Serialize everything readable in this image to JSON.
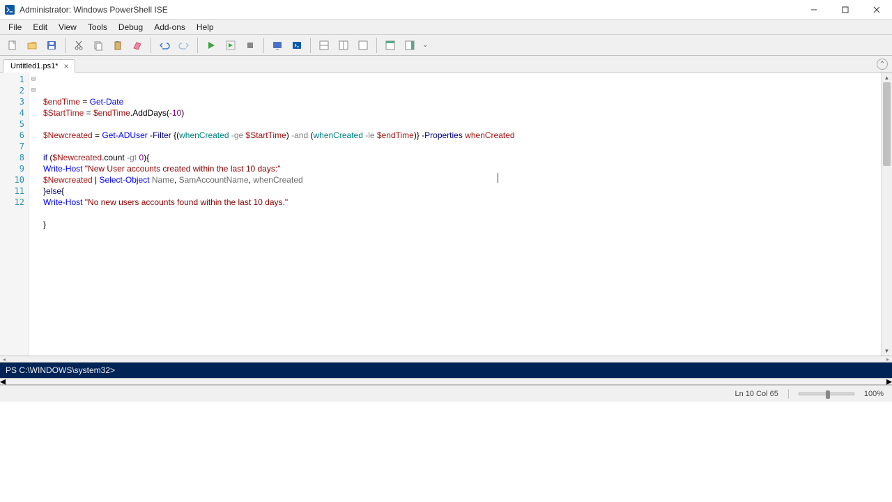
{
  "window": {
    "title": "Administrator: Windows PowerShell ISE"
  },
  "menu": {
    "items": [
      "File",
      "Edit",
      "View",
      "Tools",
      "Debug",
      "Add-ons",
      "Help"
    ]
  },
  "tabs": {
    "items": [
      {
        "label": "Untitled1.ps1*"
      }
    ]
  },
  "code": {
    "lines": [
      [
        {
          "t": "$endTime",
          "c": "tok-var"
        },
        {
          "t": " = ",
          "c": ""
        },
        {
          "t": "Get-Date",
          "c": "tok-cmd"
        }
      ],
      [
        {
          "t": "$StartTime",
          "c": "tok-var"
        },
        {
          "t": " = ",
          "c": ""
        },
        {
          "t": "$endTime",
          "c": "tok-var"
        },
        {
          "t": ".AddDays(",
          "c": "tok-member"
        },
        {
          "t": "-10",
          "c": "tok-num"
        },
        {
          "t": ")",
          "c": "tok-member"
        }
      ],
      [],
      [
        {
          "t": "$Newcreated",
          "c": "tok-var"
        },
        {
          "t": " = ",
          "c": ""
        },
        {
          "t": "Get-ADUser",
          "c": "tok-cmd"
        },
        {
          "t": " -Filter ",
          "c": "tok-param"
        },
        {
          "t": "{(",
          "c": ""
        },
        {
          "t": "whenCreated",
          "c": "tok-type"
        },
        {
          "t": " -ge ",
          "c": "tok-op"
        },
        {
          "t": "$StartTime",
          "c": "tok-var"
        },
        {
          "t": ") ",
          "c": ""
        },
        {
          "t": "-and",
          "c": "tok-op"
        },
        {
          "t": " (",
          "c": ""
        },
        {
          "t": "whenCreated",
          "c": "tok-type"
        },
        {
          "t": " -le ",
          "c": "tok-op"
        },
        {
          "t": "$endTime",
          "c": "tok-var"
        },
        {
          "t": ")} ",
          "c": ""
        },
        {
          "t": "-Properties ",
          "c": "tok-param"
        },
        {
          "t": "whenCreated",
          "c": "tok-var"
        }
      ],
      [],
      [
        {
          "t": "if",
          "c": "tok-kw"
        },
        {
          "t": " (",
          "c": ""
        },
        {
          "t": "$Newcreated",
          "c": "tok-var"
        },
        {
          "t": ".count ",
          "c": "tok-member"
        },
        {
          "t": "-gt",
          "c": "tok-op"
        },
        {
          "t": " ",
          "c": ""
        },
        {
          "t": "0",
          "c": "tok-num"
        },
        {
          "t": "){",
          "c": ""
        }
      ],
      [
        {
          "t": "Write-Host",
          "c": "tok-cmd"
        },
        {
          "t": " ",
          "c": ""
        },
        {
          "t": "\"New User accounts created within the last 10 days:\"",
          "c": "tok-str"
        }
      ],
      [
        {
          "t": "$Newcreated",
          "c": "tok-var"
        },
        {
          "t": " | ",
          "c": ""
        },
        {
          "t": "Select-Object",
          "c": "tok-cmd"
        },
        {
          "t": " Name",
          "c": "tok-prop"
        },
        {
          "t": ", ",
          "c": ""
        },
        {
          "t": "SamAccountName",
          "c": "tok-prop"
        },
        {
          "t": ", ",
          "c": ""
        },
        {
          "t": "whenCreated",
          "c": "tok-prop"
        }
      ],
      [
        {
          "t": "}",
          "c": ""
        },
        {
          "t": "else",
          "c": "tok-kw"
        },
        {
          "t": "{",
          "c": ""
        }
      ],
      [
        {
          "t": "Write-Host",
          "c": "tok-cmd"
        },
        {
          "t": " ",
          "c": ""
        },
        {
          "t": "\"No new users accounts found within the last 10 days.\"",
          "c": "tok-str"
        }
      ],
      [],
      [
        {
          "t": "}",
          "c": ""
        }
      ]
    ]
  },
  "console": {
    "prompt": "PS C:\\WINDOWS\\system32>"
  },
  "status": {
    "position": "Ln 10  Col 65",
    "zoom": "100%"
  },
  "colors": {
    "console_bg": "#012456"
  }
}
